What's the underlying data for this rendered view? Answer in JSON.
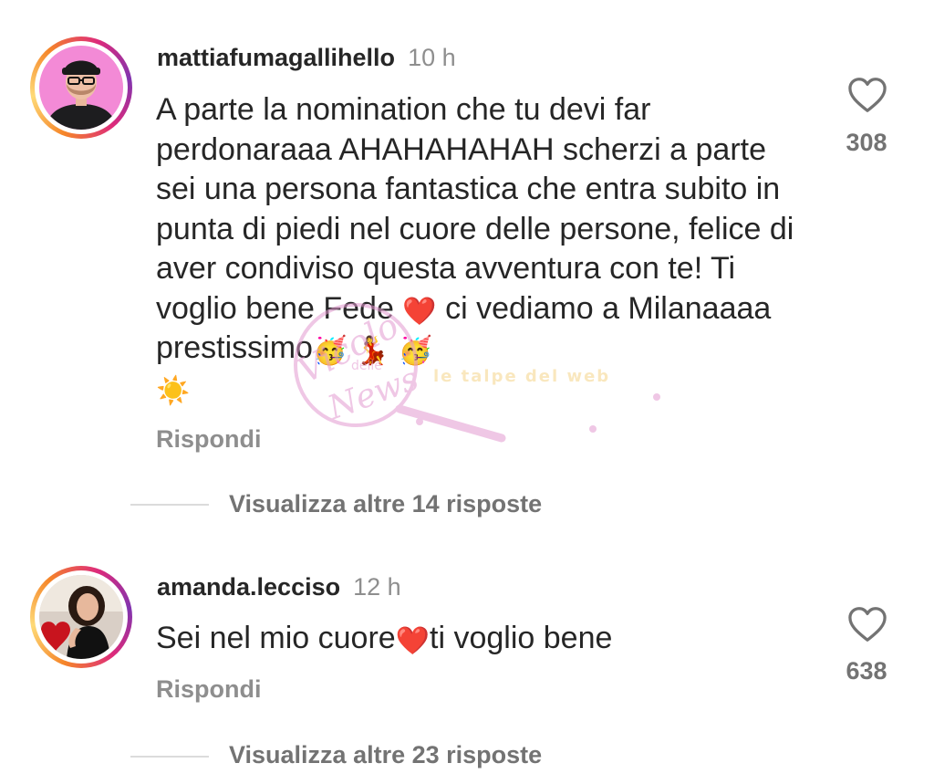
{
  "comments": [
    {
      "username": "mattiafumagallihello",
      "time": "10 h",
      "text": "A parte la nomination che tu devi far perdonaraaa AHAHAHAHAH scherzi a parte sei una persona fantastica che entra subito in punta di piedi nel cuore delle persone, felice di aver condiviso questa avventura con te! Ti voglio bene Fede ",
      "text_tail_1": " ci vediamo a Milanaaaa prestissimo",
      "emoji_heart": "❤️",
      "emoji_party": "🥳",
      "emoji_dancer": "💃",
      "emoji_sun": "☀️",
      "reply_label": "Rispondi",
      "likes": "308",
      "view_replies": "Visualizza altre 14 risposte"
    },
    {
      "username": "amanda.lecciso",
      "time": "12 h",
      "text_a": "Sei nel mio cuore",
      "emoji_heart": "❤️",
      "text_b": "ti voglio bene",
      "reply_label": "Rispondi",
      "likes": "638",
      "view_replies": "Visualizza altre 23 risposte"
    }
  ],
  "watermark": {
    "line1": "Vicolo",
    "line2": "delle",
    "line3": "News",
    "tagline": "le talpe del web"
  },
  "colors": {
    "text": "#262626",
    "secondary": "#8e8e8e",
    "divider": "#dbdbdb",
    "watermark": "#e39ad0"
  }
}
